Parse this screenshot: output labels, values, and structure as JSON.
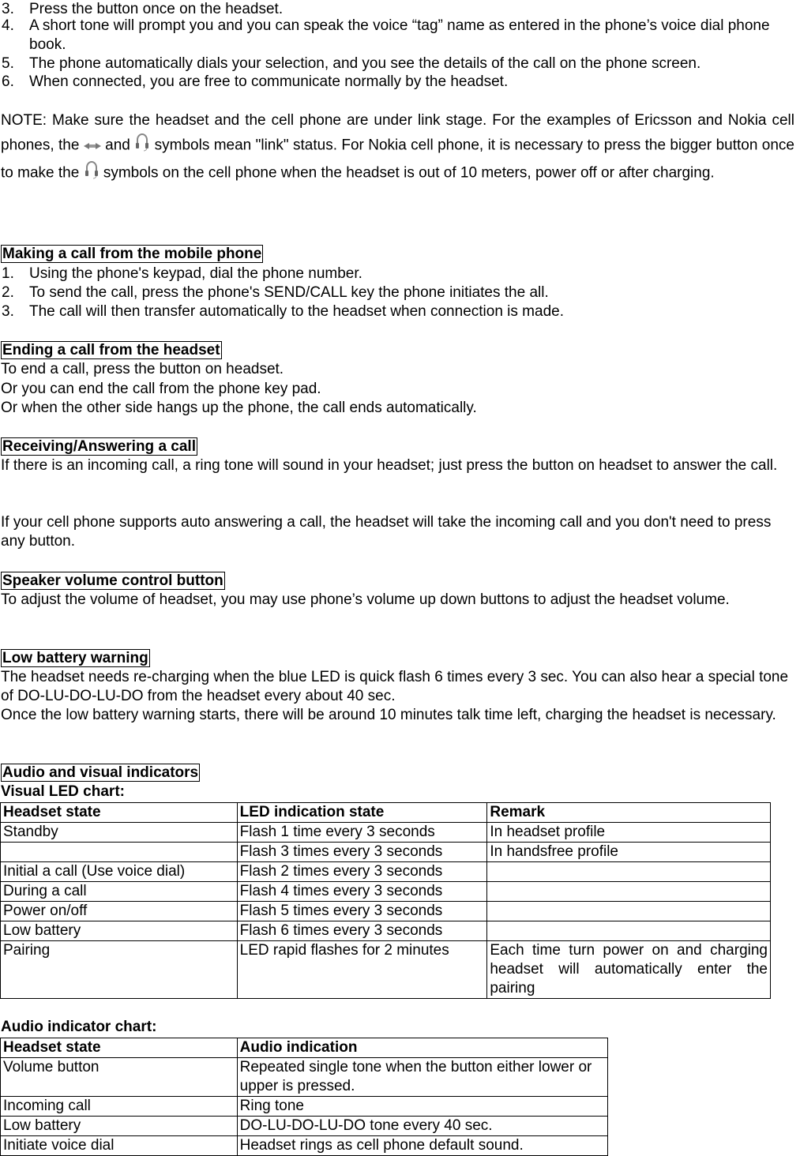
{
  "top_list": [
    {
      "num": "3.",
      "text": "Press the button once on the headset."
    },
    {
      "num": "4.",
      "text": "A short tone will prompt you and you can speak the voice “tag” name as entered in the phone’s voice dial phone book."
    },
    {
      "num": "5.",
      "text": "The phone automatically dials your selection, and you see the details of the call on the phone screen."
    },
    {
      "num": "6.",
      "text": "When connected, you are free to communicate normally by the headset."
    }
  ],
  "note": {
    "part1": "NOTE: Make sure the headset and the cell phone are under link stage. For the examples of Ericsson and Nokia cell phones, the ",
    "icon1": "link-arrows-icon",
    "part2": " and ",
    "icon2": "headset-icon",
    "part3": "  symbols mean \"link\" status. For Nokia cell phone, it is necessary to press the bigger button once to make the  ",
    "icon3": "headset-icon",
    "part4": " symbols on the cell phone when the headset is out of 10 meters, power off or after charging."
  },
  "making_call": {
    "heading": "Making a call from the mobile phone",
    "items": [
      {
        "num": "1.",
        "text": "Using the phone's keypad, dial the phone number."
      },
      {
        "num": "2.",
        "text": "To send the call, press the phone's SEND/CALL key the phone initiates the all."
      },
      {
        "num": "3.",
        "text": "The call will then transfer automatically to the headset when connection is made."
      }
    ]
  },
  "ending_call": {
    "heading": "Ending a call from the headset",
    "lines": [
      "To end a call, press the button on headset.",
      "Or you can end the call from the phone key pad.",
      "Or when the other side hangs up the phone, the call ends automatically."
    ]
  },
  "receiving_call": {
    "heading": "Receiving/Answering a call",
    "para1": "If there is an incoming call, a ring tone will sound in your headset; just press the button on headset to answer the call.",
    "para2": "If your cell phone supports auto answering a call, the headset will take the incoming call and you don't need to press any button."
  },
  "speaker_volume": {
    "heading": "Speaker volume control button",
    "text": "To adjust the volume of headset, you may use phone’s volume up down buttons to adjust the headset volume."
  },
  "low_battery": {
    "heading": "Low battery warning",
    "para1": "The headset needs re-charging when the blue LED is quick flash 6 times every 3 sec. You can also hear a special tone of DO-LU-DO-LU-DO from the headset every about 40 sec.",
    "para2": "Once the low battery warning starts, there will be around 10 minutes talk time left, charging the headset is necessary."
  },
  "indicators": {
    "heading": "Audio and visual indicators",
    "led_chart": {
      "title": "Visual LED chart:",
      "headers": [
        "Headset state",
        "LED indication state",
        "Remark"
      ],
      "rows": [
        [
          "Standby",
          "Flash 1 time every 3 seconds",
          "In headset profile"
        ],
        [
          "",
          "Flash 3 times every 3 seconds",
          "In handsfree profile"
        ],
        [
          "Initial a call (Use voice dial)",
          "Flash 2 times every 3 seconds",
          ""
        ],
        [
          "During a call",
          "Flash 4 times every 3 seconds",
          ""
        ],
        [
          "Power on/off",
          "Flash 5 times every 3 seconds",
          ""
        ],
        [
          "Low battery",
          "Flash 6 times every 3 seconds",
          ""
        ],
        [
          "Pairing",
          "LED rapid flashes for 2 minutes",
          "Each time turn power on and charging headset will automatically enter the pairing"
        ]
      ]
    },
    "audio_chart": {
      "title": "Audio indicator chart:",
      "headers": [
        "Headset state",
        "Audio indication"
      ],
      "rows": [
        [
          "Volume button",
          "Repeated single tone when the button either lower or upper is pressed."
        ],
        [
          "Incoming call",
          "Ring tone"
        ],
        [
          "Low battery",
          "DO-LU-DO-LU-DO tone every 40 sec."
        ],
        [
          "Initiate voice dial",
          "Headset rings as cell phone default sound."
        ]
      ]
    }
  }
}
